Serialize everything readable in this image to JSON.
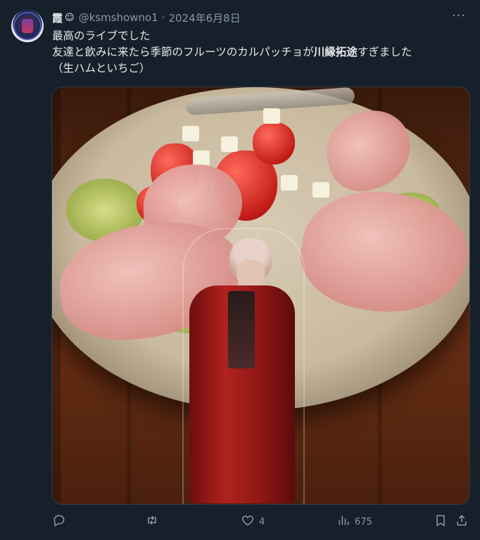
{
  "tweet": {
    "display_name": "霞",
    "badge": "☺",
    "handle": "@ksmshowno1",
    "separator": "·",
    "date": "2024年6月8日",
    "more_glyph": "⋮⋮",
    "text_line1": "最高のライブでした",
    "text_line2_before": "友達と飲みに来たら季節のフルーツのカルパッチョが",
    "text_line2_bold": "川縁拓途",
    "text_line2_after": "すぎました",
    "text_line3": "（生ハムといちご）"
  },
  "actions": {
    "reply_count": "",
    "retweet_count": "",
    "like_count": "4",
    "view_count": "675"
  },
  "icons": [
    "reply-icon",
    "retweet-icon",
    "like-icon",
    "views-icon",
    "bookmark-icon",
    "share-icon",
    "more-icon"
  ]
}
